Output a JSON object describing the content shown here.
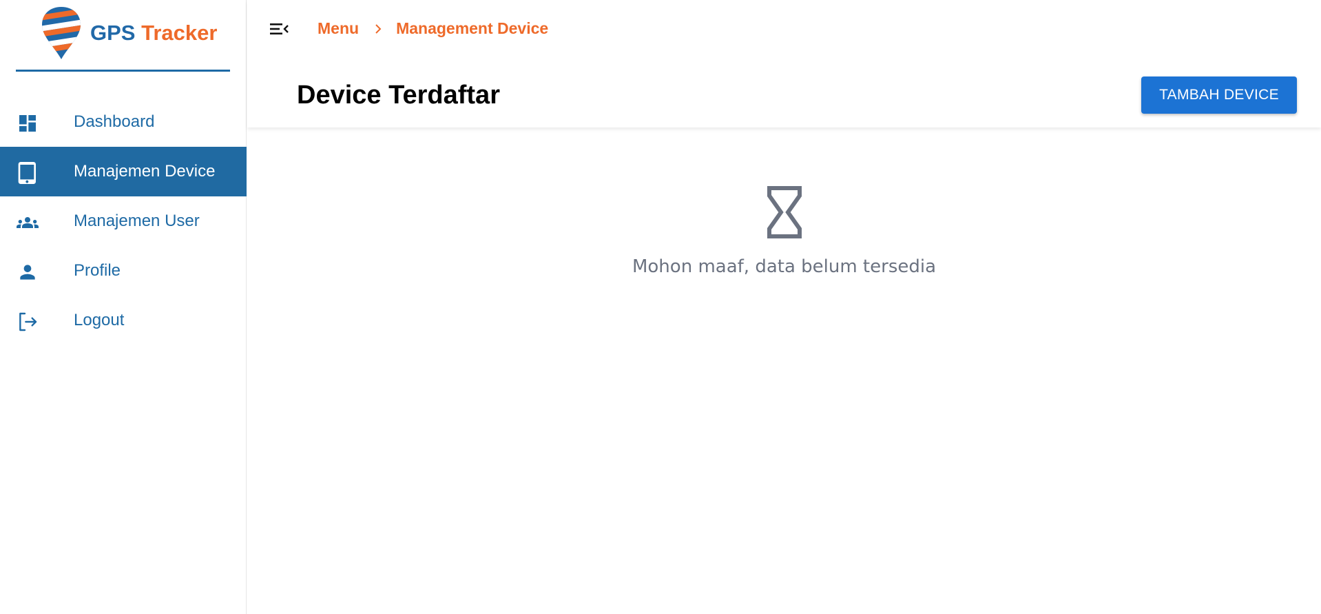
{
  "app": {
    "brand_part1": "GPS",
    "brand_part2": "Tracker"
  },
  "colors": {
    "primary": "#1e6aa5",
    "accent": "#ee6a2a",
    "button": "#1c73d4",
    "active_nav": "#206aa2",
    "muted_text": "#6b7280"
  },
  "sidebar": {
    "items": [
      {
        "label": "Dashboard",
        "icon": "dashboard-icon",
        "active": false
      },
      {
        "label": "Manajemen Device",
        "icon": "tablet-icon",
        "active": true
      },
      {
        "label": "Manajemen User",
        "icon": "group-icon",
        "active": false
      },
      {
        "label": "Profile",
        "icon": "person-icon",
        "active": false
      },
      {
        "label": "Logout",
        "icon": "logout-icon",
        "active": false
      }
    ]
  },
  "header": {
    "breadcrumb": [
      "Menu",
      "Management Device"
    ],
    "title": "Device Terdaftar",
    "add_button": "TAMBAH DEVICE"
  },
  "main": {
    "empty_icon": "hourglass-icon",
    "empty_message": "Mohon maaf, data belum tersedia"
  }
}
